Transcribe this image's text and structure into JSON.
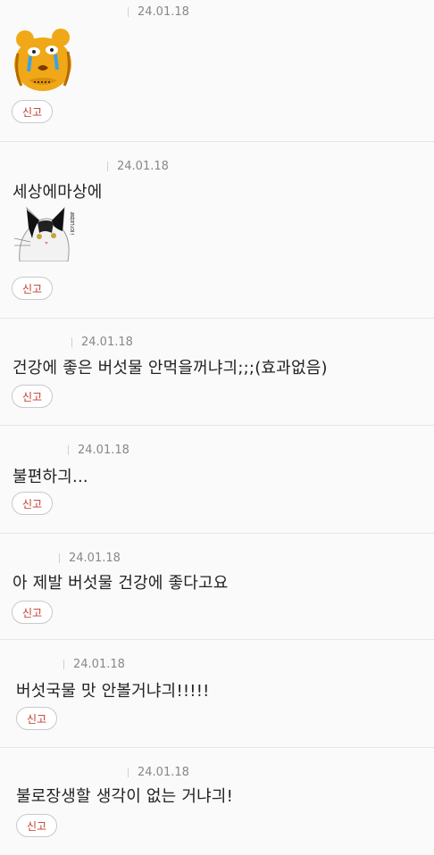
{
  "report_label": "신고",
  "comments": [
    {
      "date": "24.01.18",
      "text": ""
    },
    {
      "date": "24.01.18",
      "text": "세상에마상에",
      "sticker_text": "놀랍군요!"
    },
    {
      "date": "24.01.18",
      "text": "건강에 좋은 버섯물 안먹을꺼냐긔;;;(효과없음)"
    },
    {
      "date": "24.01.18",
      "text": "불편하긔..."
    },
    {
      "date": "24.01.18",
      "text": "아 제발 버섯물 건강에 좋다고요"
    },
    {
      "date": "24.01.18",
      "text": "버섯국물 맛 안볼거냐긔!!!!!"
    },
    {
      "date": "24.01.18",
      "text": "불로장생할 생각이 없는 거냐긔!"
    }
  ]
}
